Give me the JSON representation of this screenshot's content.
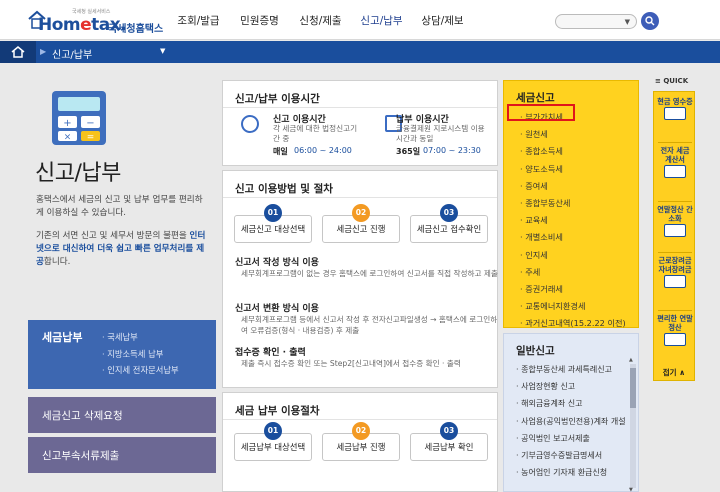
{
  "header": {
    "logo_tag": "국세청 실세서비스",
    "logo_main_a": "Hom",
    "logo_main_e": "e",
    "logo_main_b": "tax.",
    "logo_sub": "국세청홈택스",
    "gnb": [
      "조회/발급",
      "민원증명",
      "신청/제출",
      "신고/납부",
      "상담/제보"
    ],
    "active_gnb": 3
  },
  "navbar": {
    "title": "신고/납부"
  },
  "left": {
    "title": "신고/납부",
    "intro_1": "홈택스에서 세금의 신고 및 납부 업무를 편리하게 이용하실 수 있습니다.",
    "intro_2a": "기존의 서면 신고 및 세무서 방문의 불편을 ",
    "intro_2b": "인터넷으로 대신하여 더욱 쉽고 빠른 업무처리를 제공",
    "intro_2c": "합니다.",
    "main_box": {
      "label": "세금납부",
      "subs": [
        "· 국세납부",
        "· 지방소득세 납부",
        "· 인지세 전자문서납부"
      ]
    },
    "box2": "세금신고 삭제요청",
    "box3": "신고부속서류제출"
  },
  "time_card": {
    "title": "신고/납부 이용시간",
    "left_label": "신고 이용시간",
    "left_desc": "각 세금에 대한 법정신고기간 중",
    "left_time_prefix": "매일",
    "left_time": "06:00 ~ 24:00",
    "right_label": "납부 이용시간",
    "right_desc": "금융결제원 지로시스템 이용시간과 동일",
    "right_time_prefix": "365일",
    "right_time": "07:00 ~ 23:30"
  },
  "method_card": {
    "title": "신고 이용방법 및 절차",
    "steps": [
      {
        "num": "01",
        "label": "세금신고 대상선택"
      },
      {
        "num": "02",
        "label": "세금신고 진행"
      },
      {
        "num": "03",
        "label": "세금신고 접수확인"
      }
    ],
    "m1_head": "신고서 작성 방식 이용",
    "m1_desc": "세무회계프로그램이 없는 경우 홈택스에 로그인하여 신고서를 직접 작성하고 제출",
    "m2_head": "신고서 변환 방식 이용",
    "m2_desc": "세무회계프로그램 등에서 신고서 작성 후 전자신고파일생성 → 홈택스에 로그인하여 오류검증(형식 · 내용검증) 후 제출",
    "m3_head": "접수증 확인 · 출력",
    "m3_desc": "제출 즉시 접수증 확인 또는 Step2[신고내역]에서 접수증 확인 · 출력"
  },
  "pay_card": {
    "title": "세금 납부 이용절차",
    "steps": [
      {
        "num": "01",
        "label": "세금납부 대상선택"
      },
      {
        "num": "02",
        "label": "세금납부 진행"
      },
      {
        "num": "03",
        "label": "세금납부 확인"
      }
    ]
  },
  "tax_panel": {
    "title": "세금신고",
    "items": [
      "부가가치세",
      "원천세",
      "종합소득세",
      "양도소득세",
      "증여세",
      "종합부동산세",
      "교육세",
      "개별소비세",
      "인지세",
      "주세",
      "증권거래세",
      "교통에너지환경세",
      "과거신고내역(15.2.22 이전)"
    ]
  },
  "general_panel": {
    "title": "일반신고",
    "items": [
      "종합부동산세 과세특례신고",
      "사업장현황 신고",
      "해외금융계좌 신고",
      "사업용(공익법인전용)계좌 개설",
      "공익법인 보고서제출",
      "기부금영수증발급명세서",
      "농어업인 기자재 환급신청"
    ]
  },
  "quick": {
    "label": "QUICK",
    "items": [
      "현금 영수증",
      "전자 세금 계산서",
      "연말정산 간소화",
      "근로장려금 자녀장려금",
      "편리한 연말정산"
    ],
    "close": "접기"
  },
  "colors": {
    "brand": "#1a4e9d",
    "yellow": "#ffd21f",
    "highlight": "#e0151b",
    "orange": "#f39a23"
  }
}
